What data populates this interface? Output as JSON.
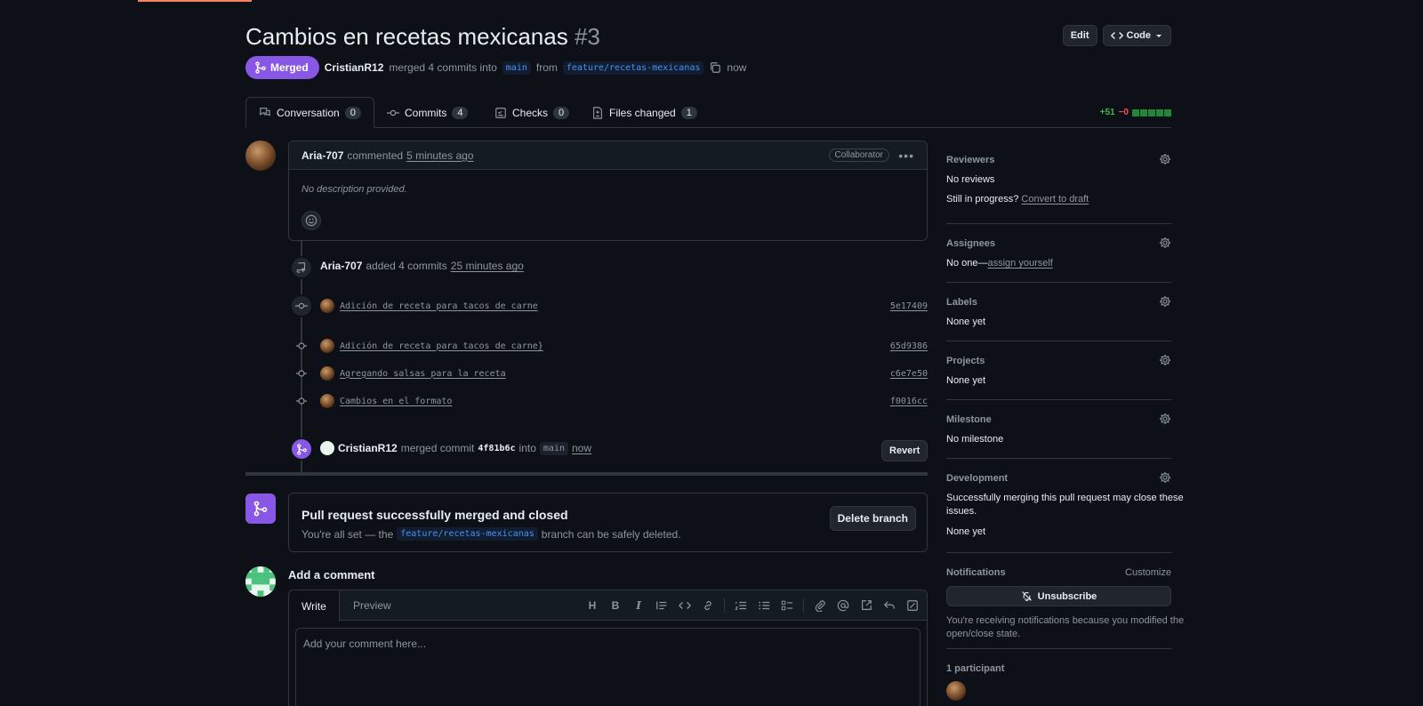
{
  "header": {
    "title": "Cambios en recetas mexicanas",
    "number": "#3",
    "edit_label": "Edit",
    "code_label": "Code"
  },
  "meta": {
    "state": "Merged",
    "author": "CristianR12",
    "text1": "merged 4 commits into",
    "base": "main",
    "text2": "from",
    "head": "feature/recetas-mexicanas",
    "time": "now"
  },
  "tabs": [
    {
      "label": "Conversation",
      "count": "0"
    },
    {
      "label": "Commits",
      "count": "4"
    },
    {
      "label": "Checks",
      "count": "0"
    },
    {
      "label": "Files changed",
      "count": "1"
    }
  ],
  "diffstat": {
    "additions": "+51",
    "deletions": "−0"
  },
  "comment": {
    "author": "Aria-707",
    "action": "commented",
    "time": "5 minutes ago",
    "badge": "Collaborator",
    "body": "No description provided."
  },
  "commits_event": {
    "author": "Aria-707",
    "action": "added 4 commits",
    "time": "25 minutes ago"
  },
  "commits": [
    {
      "message": "Adición de receta para tacos de carne",
      "sha": "5e17409"
    },
    {
      "message": "Adición de receta para tacos de carne}",
      "sha": "65d9386"
    },
    {
      "message": "Agregando salsas para la receta",
      "sha": "c6e7e50"
    },
    {
      "message": "Cambios en el formato",
      "sha": "f0016cc"
    }
  ],
  "merge_event": {
    "author": "CristianR12",
    "action": "merged commit",
    "sha": "4f81b6c",
    "into": "into",
    "branch": "main",
    "time": "now",
    "revert_label": "Revert"
  },
  "merged_box": {
    "title": "Pull request successfully merged and closed",
    "sub1": "You're all set — the",
    "branch": "feature/recetas-mexicanas",
    "sub2": "branch can be safely deleted.",
    "delete_label": "Delete branch"
  },
  "add_comment": {
    "title": "Add a comment",
    "write_tab": "Write",
    "preview_tab": "Preview",
    "placeholder": "Add your comment here..."
  },
  "sidebar": {
    "reviewers": {
      "title": "Reviewers",
      "value": "No reviews",
      "progress": "Still in progress?",
      "draft_link": "Convert to draft"
    },
    "assignees": {
      "title": "Assignees",
      "value": "No one—",
      "link": "assign yourself"
    },
    "labels": {
      "title": "Labels",
      "value": "None yet"
    },
    "projects": {
      "title": "Projects",
      "value": "None yet"
    },
    "milestone": {
      "title": "Milestone",
      "value": "No milestone"
    },
    "development": {
      "title": "Development",
      "line1": "Successfully merging this pull request may close these",
      "line2": "issues.",
      "value": "None yet"
    },
    "notifications": {
      "title": "Notifications",
      "customize": "Customize",
      "button": "Unsubscribe",
      "line1": "You're receiving notifications because you modified the",
      "line2": "open/close state."
    },
    "participants": {
      "title": "1 participant"
    }
  },
  "colors": {
    "merged": "#8957e5",
    "background": "#0d1117",
    "border": "#30363d",
    "link": "#4493f8",
    "addition": "#3fb950",
    "deletion": "#f85149"
  }
}
